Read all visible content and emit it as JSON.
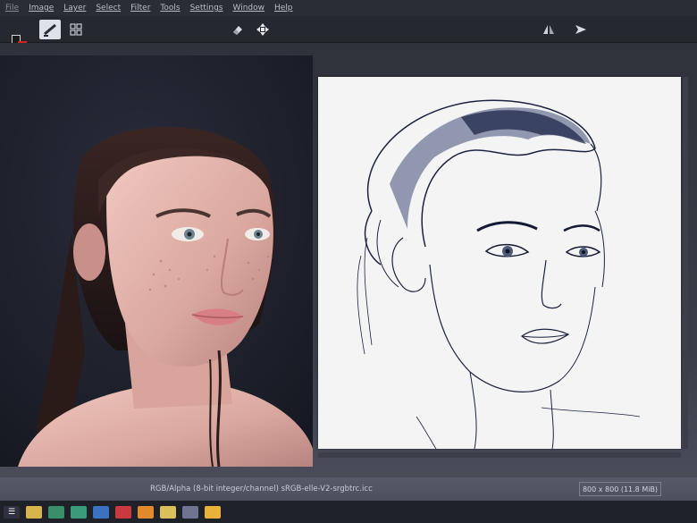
{
  "menubar": {
    "items": [
      "File",
      "Image",
      "Layer",
      "Select",
      "Filter",
      "Tools",
      "Settings",
      "Window",
      "Help"
    ]
  },
  "toolbar": {
    "foreground_color": "#1b1b1b",
    "background_color": "#d82020",
    "icons": [
      "brush-preset-icon",
      "grid-icon",
      "eraser-icon",
      "move-icon",
      "mirror-icon",
      "arrow-icon"
    ]
  },
  "statusbar": {
    "color_space": "RGB/Alpha (8-bit integer/channel)  sRGB-elle-V2-srgbtrc.icc",
    "image_size": "800 x 800 (11.8 MiB)"
  },
  "taskbar": {
    "icons": [
      "start-icon",
      "folder-icon",
      "store-icon",
      "media-icon",
      "mail-icon",
      "app-icon",
      "office-icon",
      "file-icon",
      "photo-icon",
      "krita-icon"
    ]
  }
}
